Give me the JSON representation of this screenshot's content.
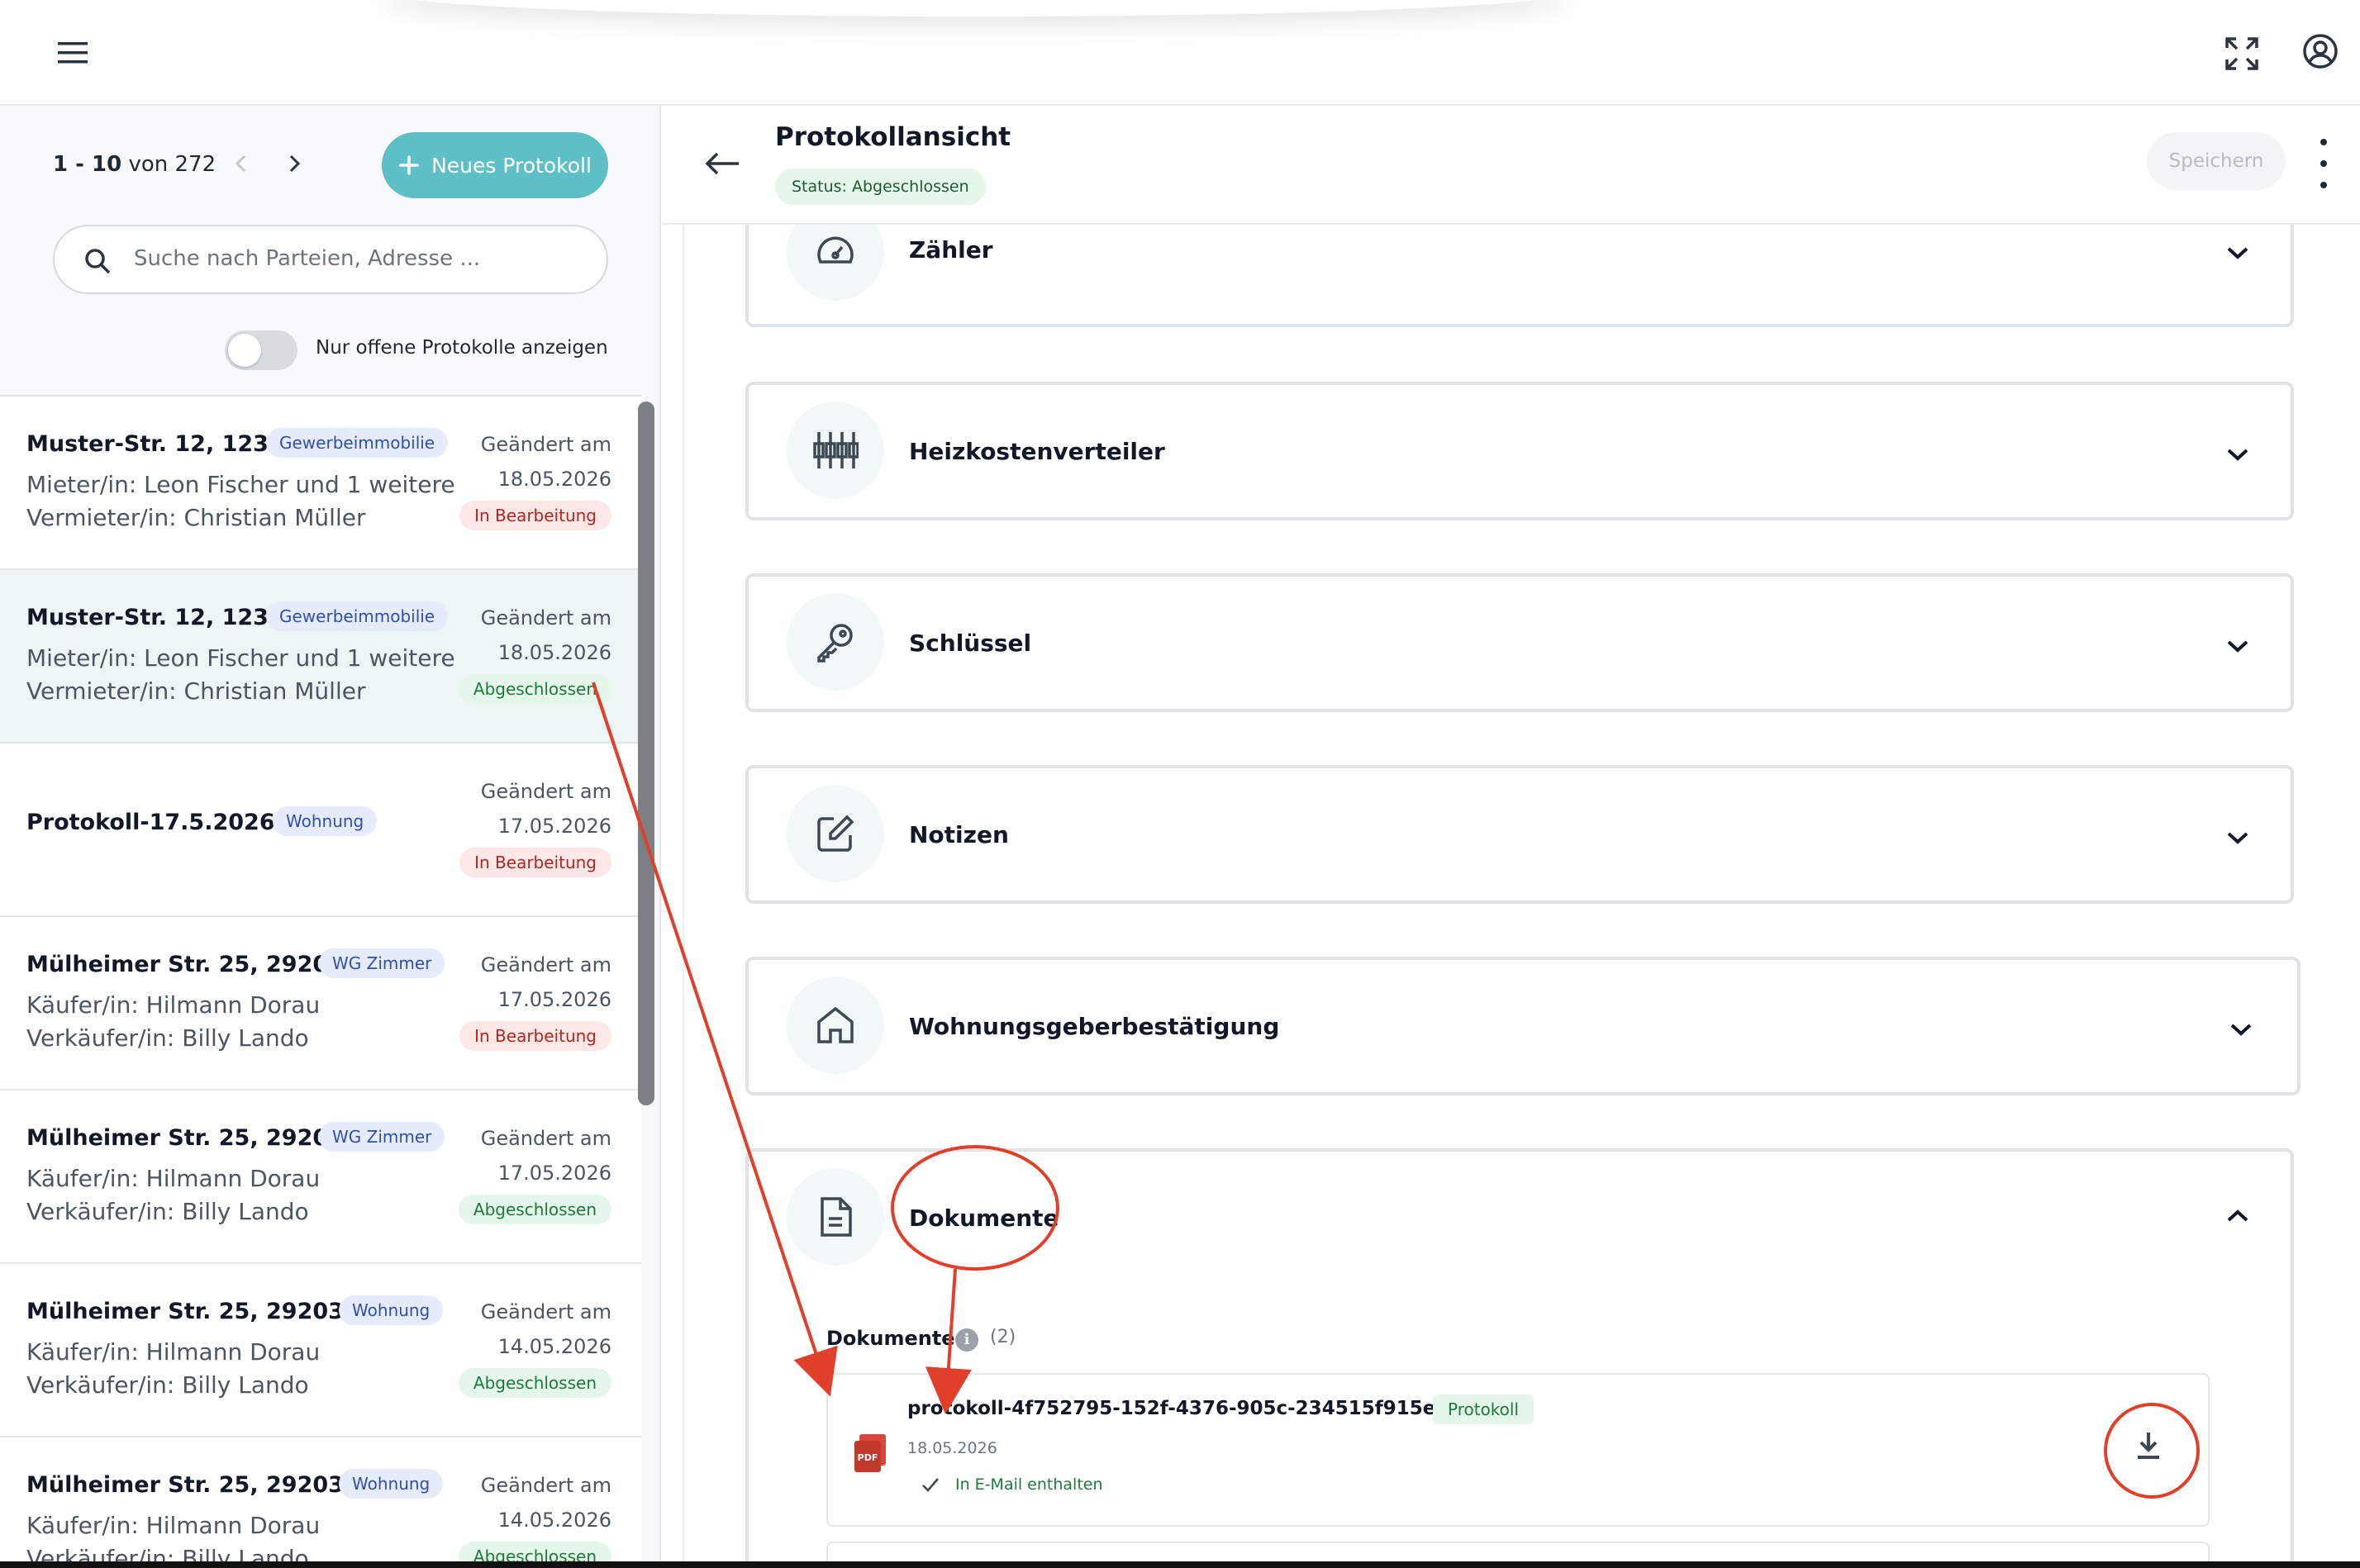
{
  "topbar": {
    "menu_icon": "hamburger-menu-icon",
    "fullscreen_icon": "fullscreen-icon",
    "account_icon": "user-account-icon"
  },
  "left": {
    "pager": {
      "range": "1 - 10",
      "of_label": "von",
      "total": "272"
    },
    "new_button_label": "Neues Protokoll",
    "search_placeholder": "Suche nach Parteien, Adresse ...",
    "toggle_label": "Nur offene Protokolle anzeigen",
    "items": [
      {
        "title": "Muster-Str. 12, 123...",
        "type": "Gewerbeimmobilie",
        "line1": "Mieter/in: Leon Fischer und 1 weitere",
        "line2": "Vermieter/in: Christian Müller",
        "changed": "Geändert am",
        "date": "18.05.2026",
        "status": "In Bearbeitung",
        "status_kind": "red"
      },
      {
        "title": "Muster-Str. 12, 123...",
        "type": "Gewerbeimmobilie",
        "line1": "Mieter/in: Leon Fischer und 1 weitere",
        "line2": "Vermieter/in: Christian Müller",
        "changed": "Geändert am",
        "date": "18.05.2026",
        "status": "Abgeschlossen",
        "status_kind": "green"
      },
      {
        "title": "Protokoll-17.5.2026-2",
        "type": "Wohnung",
        "line1": "",
        "line2": "",
        "changed": "Geändert am",
        "date": "17.05.2026",
        "status": "In Bearbeitung",
        "status_kind": "red"
      },
      {
        "title": "Mülheimer Str. 25, 2920...",
        "type": "WG Zimmer",
        "line1": "Käufer/in: Hilmann Dorau",
        "line2": "Verkäufer/in: Billy Lando",
        "changed": "Geändert am",
        "date": "17.05.2026",
        "status": "In Bearbeitung",
        "status_kind": "red"
      },
      {
        "title": "Mülheimer Str. 25, 2920...",
        "type": "WG Zimmer",
        "line1": "Käufer/in: Hilmann Dorau",
        "line2": "Verkäufer/in: Billy Lando",
        "changed": "Geändert am",
        "date": "17.05.2026",
        "status": "Abgeschlossen",
        "status_kind": "green"
      },
      {
        "title": "Mülheimer Str. 25, 29203 ...",
        "type": "Wohnung",
        "line1": "Käufer/in: Hilmann Dorau",
        "line2": "Verkäufer/in: Billy Lando",
        "changed": "Geändert am",
        "date": "14.05.2026",
        "status": "Abgeschlossen",
        "status_kind": "green"
      },
      {
        "title": "Mülheimer Str. 25, 29203 ...",
        "type": "Wohnung",
        "line1": "Käufer/in: Hilmann Dorau",
        "line2": "Verkäufer/in: Billy Lando",
        "changed": "Geändert am",
        "date": "14.05.2026",
        "status": "Abgeschlossen",
        "status_kind": "green"
      }
    ]
  },
  "right": {
    "title": "Protokollansicht",
    "status_label": "Status:",
    "status_value": "Abgeschlossen",
    "save_label": "Speichern",
    "sections": [
      {
        "label": "Zähler",
        "icon": "gauge-icon",
        "expanded": false
      },
      {
        "label": "Heizkostenverteiler",
        "icon": "heat-meter-icon",
        "expanded": false
      },
      {
        "label": "Schlüssel",
        "icon": "key-icon",
        "expanded": false
      },
      {
        "label": "Notizen",
        "icon": "edit-note-icon",
        "expanded": false
      },
      {
        "label": "Wohnungsgeberbestätigung",
        "icon": "home-icon",
        "expanded": false
      },
      {
        "label": "Dokumente",
        "icon": "document-icon",
        "expanded": true
      }
    ],
    "documents": {
      "label": "Dokumente",
      "count": "(2)",
      "items": [
        {
          "filename": "protokoll-4f752795-152f-4376-905c-234515f915ea.pdf",
          "tag": "Protokoll",
          "date": "18.05.2026",
          "mail_note": "In E-Mail enthalten",
          "file_icon": "pdf-icon",
          "file_icon_text": "PDF"
        }
      ]
    }
  },
  "colors": {
    "accent": "#5fbfc7",
    "annotation": "#e0402a",
    "status_green_bg": "#e5f6ea",
    "status_red_bg": "#fde7e7"
  }
}
